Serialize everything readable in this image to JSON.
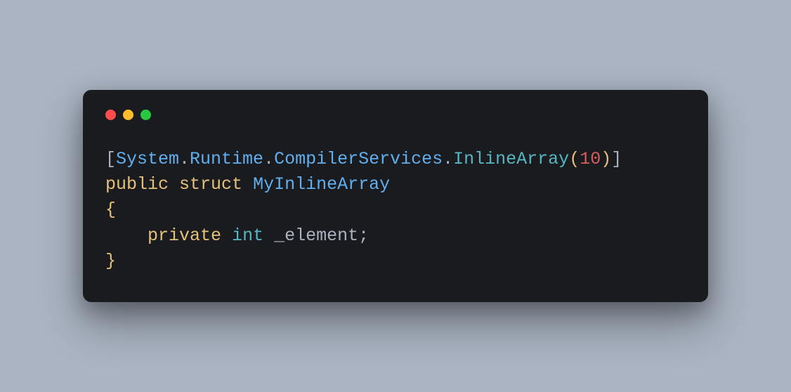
{
  "code": {
    "line1": {
      "open_bracket": "[",
      "ns1": "System",
      "dot1": ".",
      "ns2": "Runtime",
      "dot2": ".",
      "ns3": "CompilerServices",
      "dot3": ".",
      "method": "InlineArray",
      "open_paren": "(",
      "arg": "10",
      "close_paren": ")",
      "close_bracket": "]"
    },
    "line2": {
      "kw_public": "public",
      "sp1": " ",
      "kw_struct": "struct",
      "sp2": " ",
      "typename": "MyInlineArray"
    },
    "line3": {
      "open_brace": "{"
    },
    "line4": {
      "indent": "    ",
      "kw_private": "private",
      "sp1": " ",
      "type_int": "int",
      "sp2": " ",
      "field": "_element",
      "semi": ";"
    },
    "line5": {
      "close_brace": "}"
    }
  }
}
